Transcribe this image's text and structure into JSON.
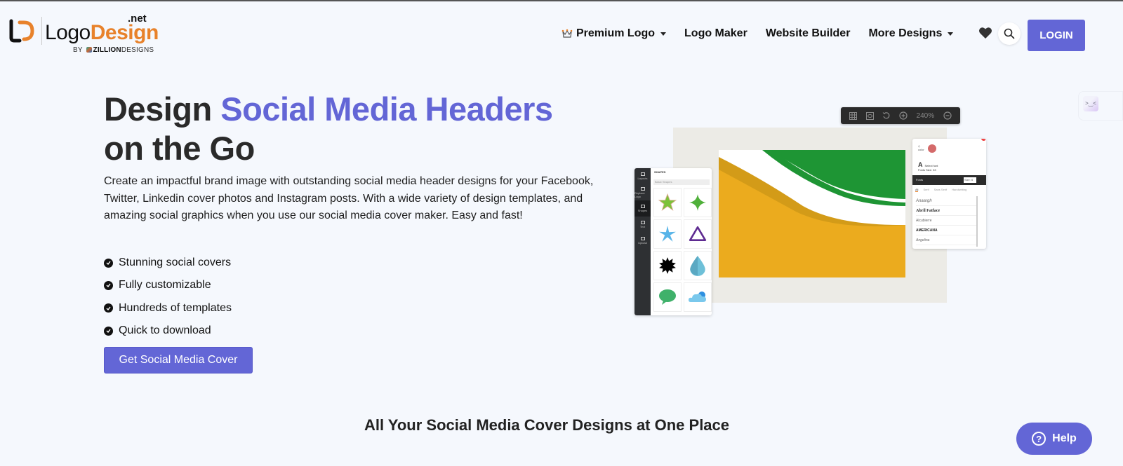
{
  "header": {
    "logo": {
      "word1": "Logo",
      "word2": "Design",
      "suffix": ".net",
      "by_prefix": "BY",
      "brand_bold": "ZILLION",
      "brand_rest": "DESIGNS"
    },
    "nav": [
      {
        "label": "Premium Logo",
        "has_dropdown": true,
        "icon": "crown-icon"
      },
      {
        "label": "Logo Maker",
        "has_dropdown": false
      },
      {
        "label": "Website Builder",
        "has_dropdown": false
      },
      {
        "label": "More Designs",
        "has_dropdown": true
      }
    ],
    "favorites_icon": "heart-icon",
    "search_icon": "search-icon",
    "login_label": "LOGIN"
  },
  "hero": {
    "title_plain": "Design ",
    "title_accent": "Social Media Headers",
    "title_line2": "on the Go",
    "description": "Create an impactful brand image with outstanding social media header designs for your Facebook, Twitter, Linkedin cover photos and Instagram posts. With a wide variety of design templates, and amazing social graphics when you use our social media cover maker. Easy and fast!",
    "features": [
      "Stunning social covers",
      "Fully customizable",
      "Hundreds of templates",
      "Quick to download"
    ],
    "cta_label": "Get Social Media Cover"
  },
  "mockup": {
    "zoom_level": "240%",
    "side_rail": [
      "Layouts",
      "Replace Logo",
      "Shapes",
      "Text",
      "Upload"
    ],
    "active_rail": "Shapes",
    "shapes_title": "SHAPES",
    "shapes_dropdown": "Basic Shapes",
    "shapes": [
      "green-star",
      "green-sparkle",
      "blue-star",
      "purple-triangle",
      "black-burst",
      "blue-drop",
      "green-speech-bubble",
      "blue-cloud"
    ],
    "color_label": "color",
    "font_label": "Select font",
    "font_sub": "Fonts  Size: 33",
    "fonts_bar": "Fonts",
    "size_select": "Size: 6",
    "font_tabs": [
      "All",
      "Serif",
      "Sans Serif",
      "Handwriting"
    ],
    "font_list": [
      "Anaargh",
      "Abril Fatface",
      "Alcubierre",
      "AMERICANA",
      "Angelina"
    ]
  },
  "section": {
    "title": "All Your Social Media Cover Designs at One Place"
  },
  "help": {
    "label": "Help"
  },
  "colors": {
    "accent": "#6366d6",
    "logo_orange": "#e8822b",
    "cover_green": "#1e9534",
    "cover_yellow": "#ebab1e"
  }
}
